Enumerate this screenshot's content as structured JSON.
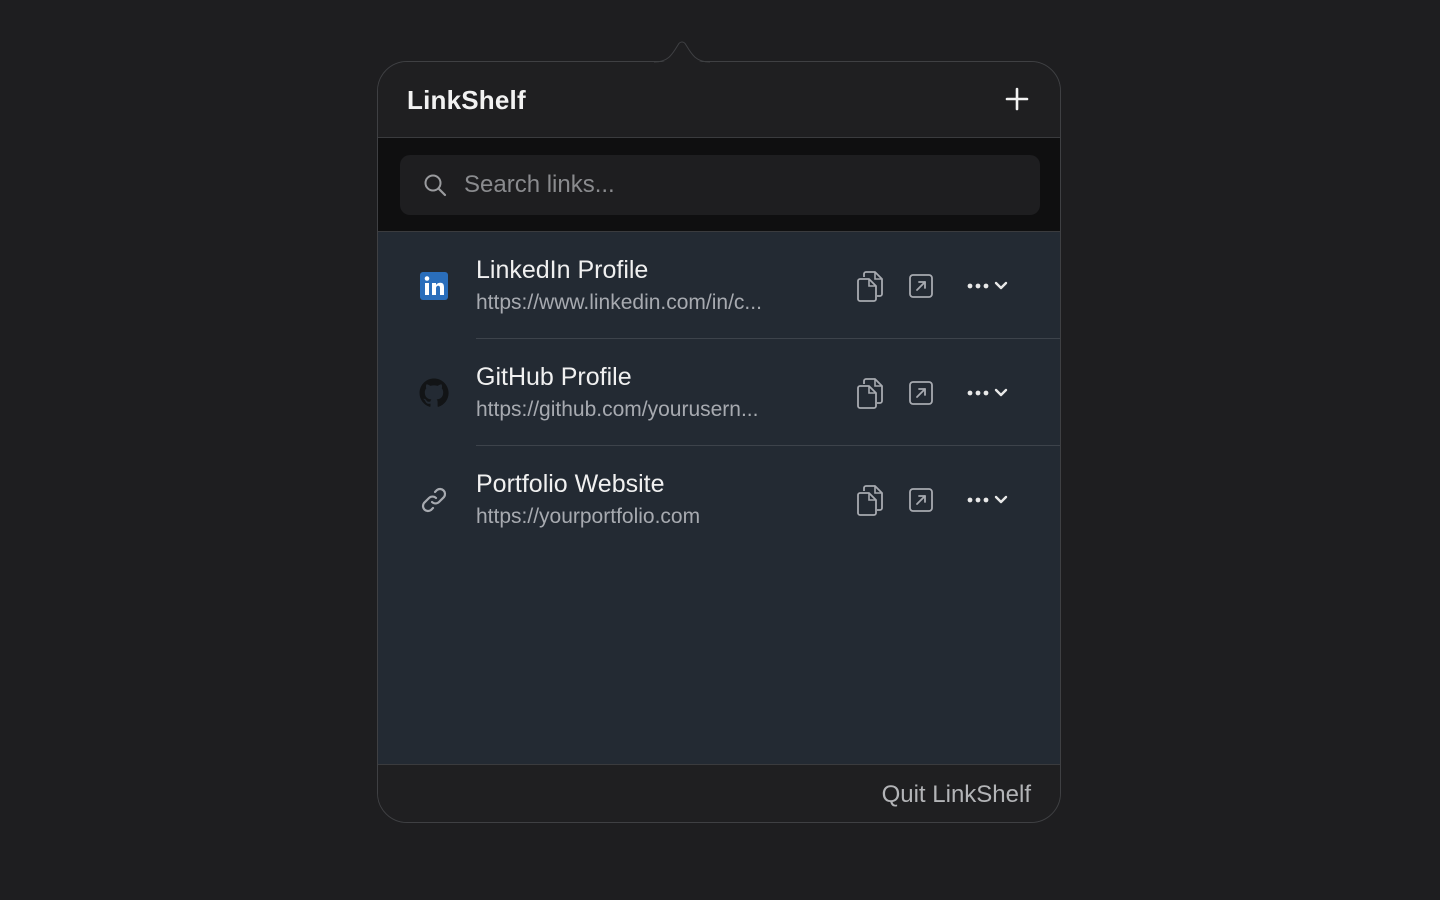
{
  "app": {
    "title": "LinkShelf",
    "add_icon": "plus-icon"
  },
  "search": {
    "placeholder": "Search links...",
    "value": "",
    "icon": "search-icon"
  },
  "links": [
    {
      "title": "LinkedIn Profile",
      "url": "https://www.linkedin.com/in/c...",
      "icon": "linkedin-icon"
    },
    {
      "title": "GitHub Profile",
      "url": "https://github.com/yourusern...",
      "icon": "github-icon"
    },
    {
      "title": "Portfolio Website",
      "url": "https://yourportfolio.com",
      "icon": "link-icon"
    }
  ],
  "row_actions": {
    "copy_icon": "copy-icon",
    "open_icon": "open-external-icon",
    "more_icon": "more-options-icon"
  },
  "footer": {
    "quit_label": "Quit LinkShelf"
  },
  "colors": {
    "background": "#1e1e20",
    "header": "#1f1f21",
    "search_band": "#0f0f10",
    "list": "#232a33",
    "linkedin_brand": "#2a6ebb"
  }
}
